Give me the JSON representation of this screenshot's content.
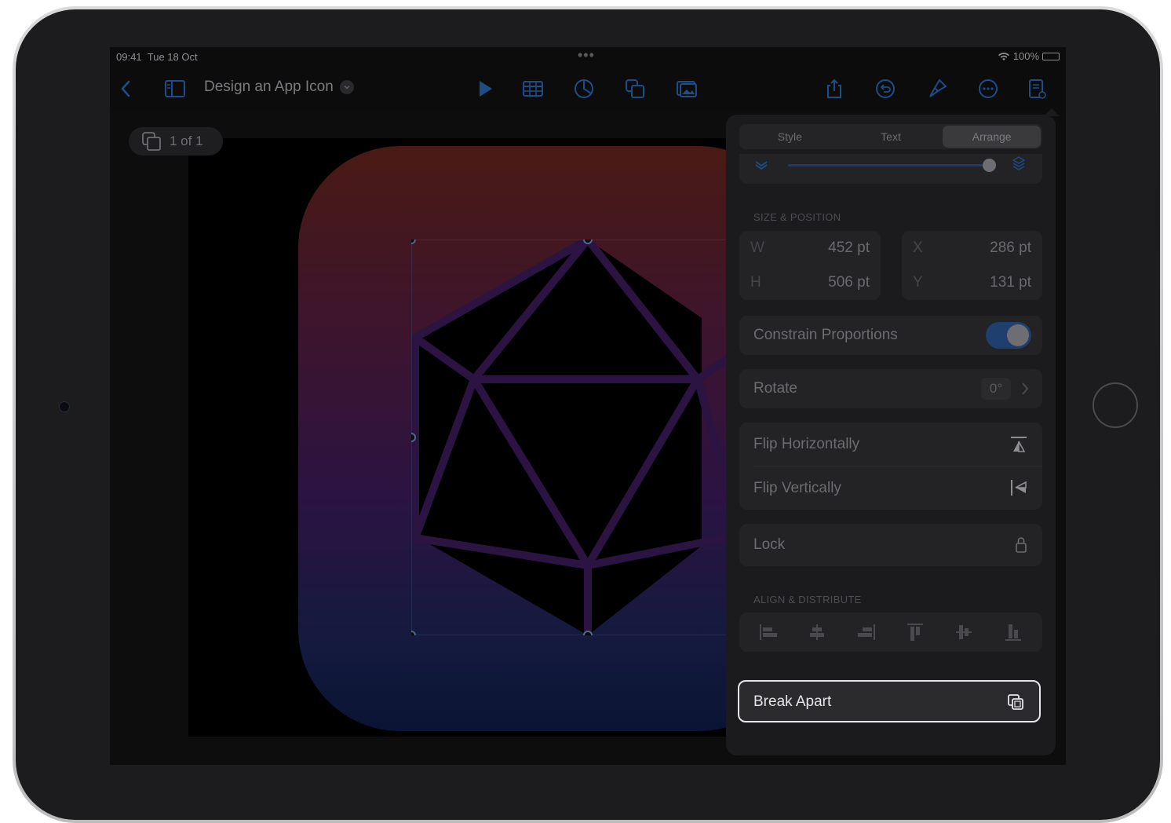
{
  "status_bar": {
    "time": "09:41",
    "date": "Tue 18 Oct",
    "dots": "•••",
    "battery": "100%"
  },
  "toolbar": {
    "doc_title": "Design an App Icon",
    "icons": [
      "back-chevron-icon",
      "sidebar-icon",
      "play-icon",
      "table-icon",
      "chart-icon",
      "shapes-icon",
      "media-icon",
      "share-icon",
      "undo-icon",
      "format-brush-icon",
      "more-icon",
      "document-icon"
    ]
  },
  "canvas": {
    "page_indicator": "1 of 1"
  },
  "panel": {
    "tabs": [
      "Style",
      "Text",
      "Arrange"
    ],
    "active_tab": "Arrange",
    "size_position": {
      "label": "SIZE & POSITION",
      "w_key": "W",
      "w_val": "452 pt",
      "h_key": "H",
      "h_val": "506 pt",
      "x_key": "X",
      "x_val": "286 pt",
      "y_key": "Y",
      "y_val": "131 pt"
    },
    "constrain": {
      "label": "Constrain Proportions",
      "on": true
    },
    "rotate": {
      "label": "Rotate",
      "value": "0°"
    },
    "flip_h": "Flip Horizontally",
    "flip_v": "Flip Vertically",
    "lock": "Lock",
    "align_label": "ALIGN & DISTRIBUTE",
    "break_apart": "Break Apart"
  },
  "colors": {
    "accent": "#1f3f6e",
    "panel_bg": "#1b1b1d",
    "card_bg": "#232325"
  }
}
